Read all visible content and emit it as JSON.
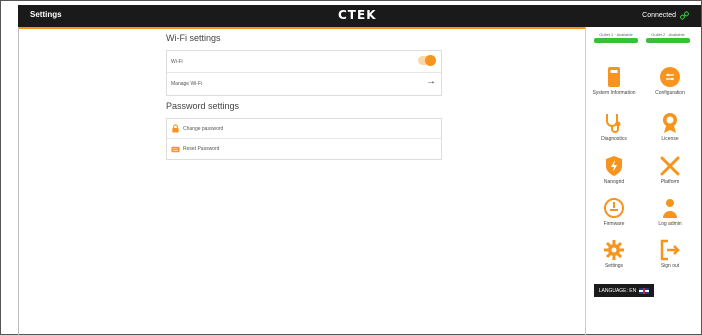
{
  "header": {
    "title": "Settings",
    "logo": "CTEK",
    "status": "Connected",
    "status_icon": "link-icon"
  },
  "wifi_section": {
    "heading": "Wi-Fi settings",
    "rows": [
      {
        "label": "Wi-Fi",
        "control": "toggle",
        "enabled": true
      },
      {
        "label": "Manage Wi-Fi",
        "control": "arrow",
        "arrow": "→"
      }
    ]
  },
  "password_section": {
    "heading": "Password settings",
    "rows": [
      {
        "label": "Change password",
        "icon": "lock-icon"
      },
      {
        "label": "Reset Password",
        "icon": "keyboard-icon"
      }
    ]
  },
  "batteries": [
    {
      "label": "Outlet 1 · Available"
    },
    {
      "label": "Outlet 2 · Available"
    }
  ],
  "menu": [
    {
      "label": "System Information",
      "icon": "info-phone-icon"
    },
    {
      "label": "Configuration",
      "icon": "configuration-icon"
    },
    {
      "label": "Diagnostics",
      "icon": "stethoscope-icon"
    },
    {
      "label": "License",
      "icon": "award-icon"
    },
    {
      "label": "Nanogrid",
      "icon": "shield-bolt-icon"
    },
    {
      "label": "Platform",
      "icon": "tools-icon"
    },
    {
      "label": "Firmware",
      "icon": "firmware-icon"
    },
    {
      "label": "Log admin",
      "icon": "user-icon"
    },
    {
      "label": "Settings",
      "icon": "gear-icon"
    },
    {
      "label": "Sign out",
      "icon": "sign-out-icon"
    }
  ],
  "language": {
    "label": "LANGUAGE: EN",
    "flag": "uk-flag-icon"
  },
  "colors": {
    "accent": "#f7941d",
    "header_bg": "#1a1a1a",
    "battery_ok": "#3bbf3b"
  }
}
